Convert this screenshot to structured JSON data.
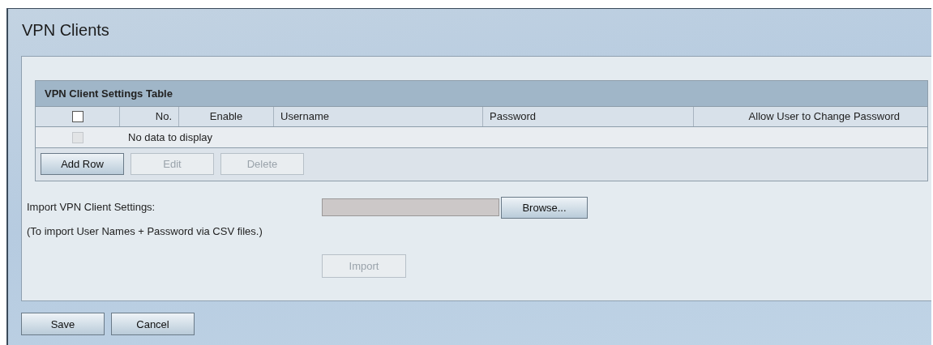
{
  "page": {
    "title": "VPN Clients"
  },
  "table": {
    "title": "VPN Client Settings Table",
    "select_all": {
      "checked": false,
      "disabled": false
    },
    "columns": [
      {
        "label": "No."
      },
      {
        "label": "Enable"
      },
      {
        "label": "Username"
      },
      {
        "label": "Password"
      },
      {
        "label": "Allow User to Change Password"
      }
    ],
    "empty_row": {
      "checkbox": {
        "checked": false,
        "disabled": true
      },
      "message": "No data to display"
    },
    "buttons": [
      {
        "label": "Add Row",
        "disabled": false
      },
      {
        "label": "Edit",
        "disabled": true
      },
      {
        "label": "Delete",
        "disabled": true
      }
    ]
  },
  "import": {
    "label": "Import VPN Client Settings:",
    "file_field": {
      "disabled": true
    },
    "browse_button": {
      "label": "Browse...",
      "disabled": false
    },
    "note": "(To import User Names + Password via CSV files.)",
    "import_button": {
      "label": "Import",
      "disabled": true
    }
  },
  "footer_buttons": [
    {
      "label": "Save",
      "disabled": false
    },
    {
      "label": "Cancel",
      "disabled": false
    }
  ]
}
